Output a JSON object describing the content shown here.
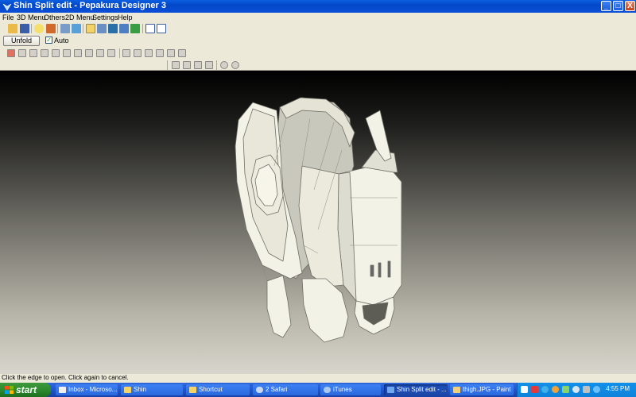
{
  "window": {
    "title": "Shin Split edit - Pepakura Designer 3",
    "minimize": "_",
    "maximize": "□",
    "close": "X"
  },
  "menu": {
    "items": [
      "File",
      "3D Menu",
      "Others",
      "2D Menu",
      "Settings",
      "Help"
    ]
  },
  "toolbar": {
    "unfold_label": "Unfold",
    "auto_label": "Auto",
    "auto_checked": "✓"
  },
  "status": {
    "text": "Click the edge to open. Click again to cancel."
  },
  "taskbar": {
    "start_label": "start",
    "tasks": [
      {
        "label": "Inbox - Microso...",
        "icon_color": "#f0f0f0"
      },
      {
        "label": "Shin",
        "icon_color": "#f5d36b"
      },
      {
        "label": "Shortcut",
        "icon_color": "#f5d36b"
      },
      {
        "label": "2 Safari",
        "icon_color": "#c7d8f0"
      },
      {
        "label": "iTunes",
        "icon_color": "#a9c8ef"
      },
      {
        "label": "Shin Split edit - ...",
        "icon_color": "#6ea9f0"
      },
      {
        "label": "thigh.JPG - Paint",
        "icon_color": "#f0d080"
      }
    ],
    "clock": "4:55 PM"
  },
  "colors": {
    "title_blue": "#0a4fd6",
    "face": "#ece9d8",
    "model_fill": "#f3f2e6",
    "model_stroke": "#6e6e66"
  }
}
